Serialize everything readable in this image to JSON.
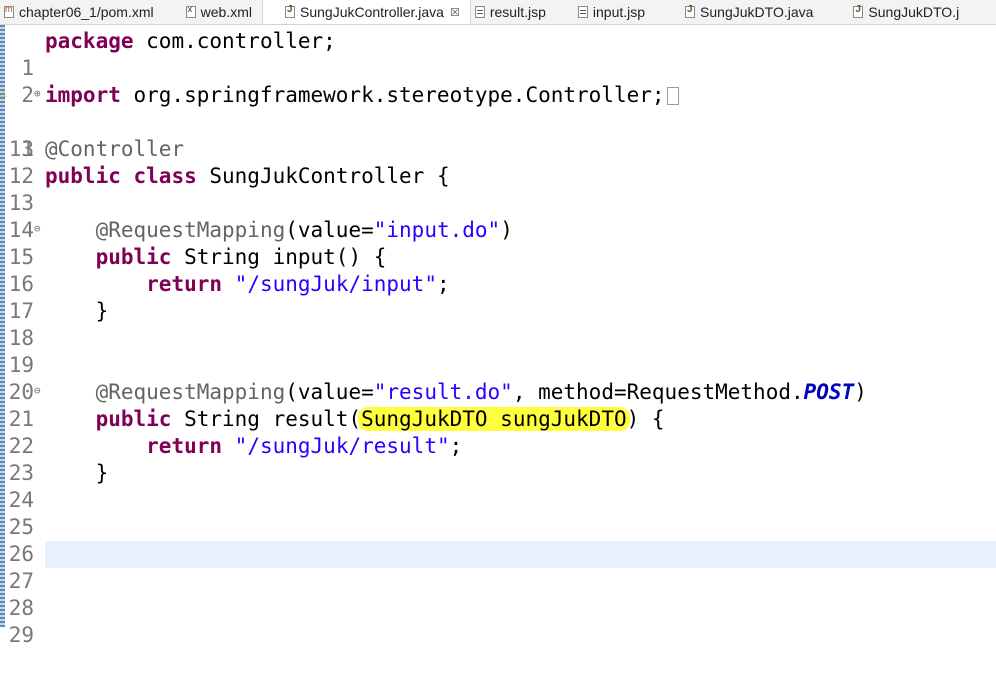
{
  "tabs": [
    {
      "label": "chapter06_1/pom.xml",
      "icon": "maven-file-icon",
      "active": false
    },
    {
      "label": "web.xml",
      "icon": "xml-file-icon",
      "active": false
    },
    {
      "label": "SungJukController.java",
      "icon": "java-file-icon",
      "active": true,
      "close": "☒"
    },
    {
      "label": "result.jsp",
      "icon": "jsp-file-icon",
      "active": false
    },
    {
      "label": "input.jsp",
      "icon": "jsp-file-icon",
      "active": false
    },
    {
      "label": "SungJukDTO.java",
      "icon": "java-file-icon",
      "active": false
    },
    {
      "label": "SungJukDTO.j",
      "icon": "java-file-icon",
      "active": false
    }
  ],
  "editor": {
    "line_numbers": [
      "1",
      "2",
      "3",
      "11",
      "12",
      "13",
      "14",
      "15",
      "16",
      "17",
      "18",
      "19",
      "20",
      "21",
      "22",
      "23",
      "24",
      "25",
      "26",
      "27",
      "28",
      "29"
    ],
    "code": {
      "package_kw": "package",
      "package_name": " com.controller;",
      "import_kw": "import",
      "import_name": " org.springframework.stereotype.Controller;",
      "controller_annotation": "@Controller",
      "public_kw": "public",
      "class_kw": "class",
      "class_name": " SungJukController {",
      "indent4": "    ",
      "indent8": "        ",
      "request_mapping": "@RequestMapping",
      "value_open": "(value=",
      "input_do": "\"input.do\"",
      "close_paren": ")",
      "string_type": " String ",
      "input_sig": "input() {",
      "return_kw": "return",
      "space": " ",
      "input_path": "\"/sungJuk/input\"",
      "semicolon": ";",
      "close_brace": "}",
      "result_do": "\"result.do\"",
      "method_part": ", method=RequestMethod.",
      "post_const": "POST",
      "result_open": "result(",
      "param_text": "SungJukDTO sungJukDTO",
      "result_close": ") {",
      "result_path": "\"/sungJuk/result\""
    }
  },
  "colors": {
    "keyword": "#7f0055",
    "annotation": "#646464",
    "string": "#2a00ff",
    "constant": "#0000c0",
    "highlight": "#ffff40",
    "current_line": "#e8f2fe"
  }
}
